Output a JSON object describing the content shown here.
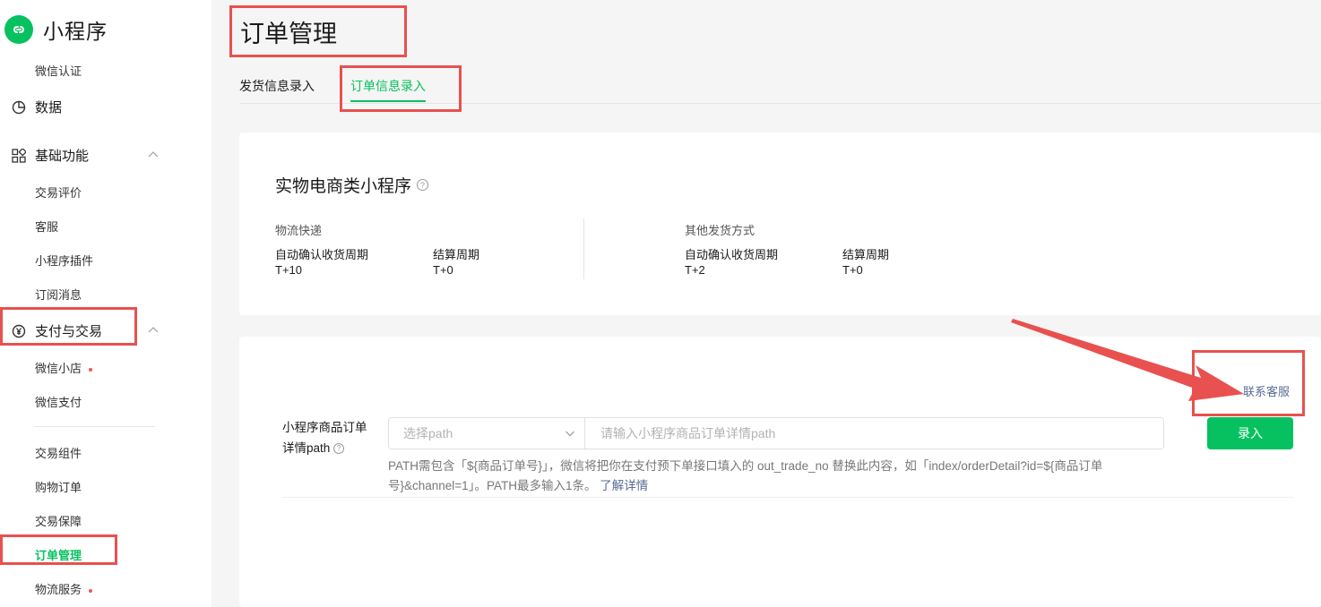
{
  "app": {
    "title": "小程序"
  },
  "sidebar": {
    "top_item": "微信认证",
    "data_label": "数据",
    "basic": {
      "label": "基础功能",
      "items": [
        "交易评价",
        "客服",
        "小程序插件",
        "订阅消息"
      ]
    },
    "payment": {
      "label": "支付与交易",
      "items": [
        "微信小店",
        "微信支付"
      ]
    },
    "trade": {
      "items": [
        "交易组件",
        "购物订单",
        "交易保障",
        "订单管理",
        "物流服务"
      ]
    }
  },
  "page": {
    "title": "订单管理"
  },
  "tabs": [
    {
      "label": "发货信息录入"
    },
    {
      "label": "订单信息录入",
      "active": true
    }
  ],
  "card": {
    "title": "实物电商类小程序",
    "logistics": {
      "title": "物流快递",
      "auto_confirm_label": "自动确认收货周期",
      "auto_confirm_value": "T+10",
      "settlement_label": "结算周期",
      "settlement_value": "T+0"
    },
    "other": {
      "title": "其他发货方式",
      "auto_confirm_label": "自动确认收货周期",
      "auto_confirm_value": "T+2",
      "settlement_label": "结算周期",
      "settlement_value": "T+0"
    }
  },
  "form": {
    "contact_link": "联系客服",
    "label_line1": "小程序商品订单",
    "label_line2": "详情path",
    "select_placeholder": "选择path",
    "input_placeholder": "请输入小程序商品订单详情path",
    "submit_label": "录入",
    "hint_text": "PATH需包含「${商品订单号}」，微信将把你在支付预下单接口填入的 out_trade_no 替换此内容，如「index/orderDetail?id=${商品订单号}&channel=1」。PATH最多输入1条。",
    "hint_link": "了解详情"
  },
  "colors": {
    "accent": "#07c160",
    "link": "#576b95",
    "annotation": "#e8514f",
    "dot": "#fa5151"
  }
}
